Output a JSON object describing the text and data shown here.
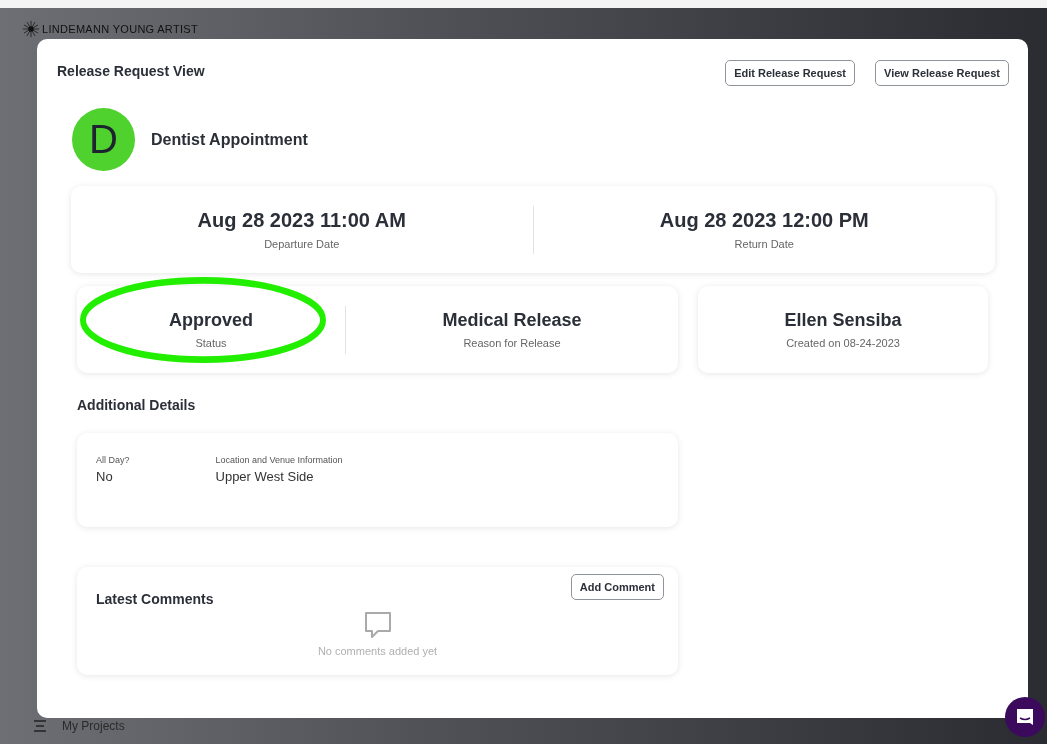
{
  "background": {
    "brand": "LINDEMANN YOUNG ARTIST",
    "sidebar_item": "My Projects"
  },
  "modal": {
    "title": "Release Request View",
    "buttons": [
      "Edit Release Request",
      "View Release Request"
    ]
  },
  "request": {
    "avatar_letter": "D",
    "name": "Dentist Appointment"
  },
  "dates": [
    {
      "value": "Aug 28 2023 11:00 AM",
      "label": "Departure Date"
    },
    {
      "value": "Aug 28 2023 12:00 PM",
      "label": "Return Date"
    }
  ],
  "summary": [
    {
      "value": "Approved",
      "label": "Status",
      "highlighted": true
    },
    {
      "value": "Medical Release",
      "label": "Reason for Release",
      "highlighted": false
    }
  ],
  "creator": {
    "name": "Ellen Sensiba",
    "created": "Created on 08-24-2023"
  },
  "additional_details": {
    "heading": "Additional Details",
    "fields": [
      {
        "label": "All Day?",
        "value": "No"
      },
      {
        "label": "Location and Venue Information",
        "value": "Upper West Side"
      }
    ]
  },
  "comments": {
    "heading": "Latest Comments",
    "button": "Add Comment",
    "empty_text": "No comments added yet"
  }
}
